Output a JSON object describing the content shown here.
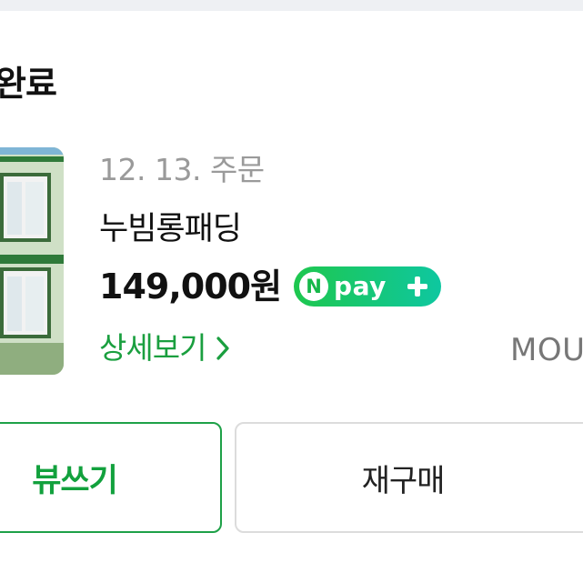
{
  "order": {
    "status_heading": "완료",
    "date": "12. 13. 주문",
    "product_name": "누빔롱패딩",
    "price": "149,000원",
    "detail_link": "상세보기",
    "brand": "MOU"
  },
  "npay": {
    "n_letter": "N",
    "label": "pay"
  },
  "actions": {
    "review_label": "뷰쓰기",
    "rebuy_label": "재구매"
  },
  "colors": {
    "accent_green": "#1ea148",
    "npay_gradient_start": "#1ec74e",
    "npay_gradient_end": "#0ec7a0"
  },
  "icons": {
    "plus": "plus-icon",
    "chevron": "chevron-right-icon"
  }
}
